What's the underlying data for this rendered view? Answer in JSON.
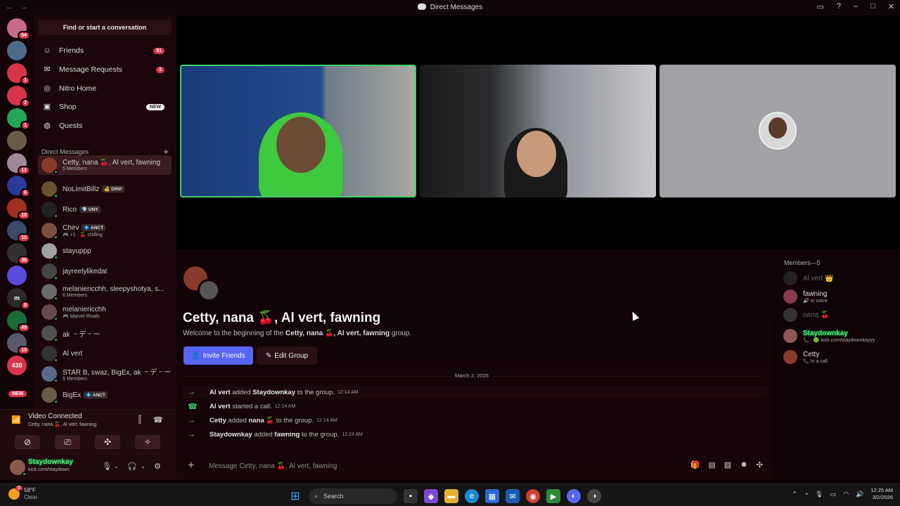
{
  "window": {
    "title": "Direct Messages"
  },
  "guilds": [
    {
      "label": "",
      "badge": "54",
      "color": "#c86a8a"
    },
    {
      "label": "",
      "badge": "",
      "color": "#4e6a8a"
    },
    {
      "label": "",
      "badge": "1",
      "color": "#d8344a"
    },
    {
      "label": "",
      "badge": "2",
      "color": "#d8344a"
    },
    {
      "label": "",
      "badge": "1",
      "color": "#23a55a"
    },
    {
      "label": "",
      "badge": "",
      "color": "#6a5a4a"
    },
    {
      "label": "",
      "badge": "12",
      "color": "#a08898"
    },
    {
      "label": "",
      "badge": "6",
      "color": "#2a3a9a"
    },
    {
      "label": "",
      "badge": "10",
      "color": "#a03020"
    },
    {
      "label": "",
      "badge": "10",
      "color": "#3a4a6a"
    },
    {
      "label": "",
      "badge": "38",
      "color": "#303030"
    },
    {
      "label": "",
      "badge": "",
      "color": "#5a4ae0"
    },
    {
      "label": "m",
      "badge": "9",
      "color": "#2a2a2a"
    },
    {
      "label": "",
      "badge": "49",
      "color": "#1a6a3a"
    },
    {
      "label": "",
      "badge": "10",
      "color": "#5a5a6a"
    },
    {
      "label": "430",
      "badge": "",
      "color": "#d8344a"
    }
  ],
  "sidebar": {
    "find_label": "Find or start a conversation",
    "nav": [
      {
        "label": "Friends",
        "count": "51",
        "icon": "friends-icon",
        "glyph": "☺"
      },
      {
        "label": "Message Requests",
        "count": "3",
        "icon": "mail-icon",
        "glyph": "✉"
      },
      {
        "label": "Nitro Home",
        "count": "",
        "icon": "nitro-icon",
        "glyph": "◎"
      },
      {
        "label": "Shop",
        "count": "",
        "badge": "NEW",
        "icon": "shop-icon",
        "glyph": "▣"
      },
      {
        "label": "Quests",
        "count": "",
        "icon": "quests-icon",
        "glyph": "◍"
      }
    ],
    "dm_header": "Direct Messages",
    "dms": [
      {
        "name": "Cetty, nana 🍒, Al vert, fawning",
        "sub": "5 Members",
        "tag": "",
        "color": "#8a3a2a",
        "active": true
      },
      {
        "name": "NoLimitBillz",
        "sub": "",
        "tag": "💰 DRIP",
        "color": "#6a5030"
      },
      {
        "name": "Rico",
        "sub": "",
        "tag": "💎 UNY",
        "color": "#222"
      },
      {
        "name": "Chev",
        "sub": "🎮 +1 · 🍒 chilling",
        "tag": "💠 ANCT",
        "color": "#7a5040"
      },
      {
        "name": "stayuppp",
        "sub": "",
        "tag": "",
        "color": "#a0a0a0"
      },
      {
        "name": "jayreelylikedat",
        "sub": "",
        "tag": "",
        "color": "#444"
      },
      {
        "name": "melaniericchh, sleepyshotya, s...",
        "sub": "6 Members",
        "tag": "",
        "color": "#6a6a6a"
      },
      {
        "name": "melaniericchh",
        "sub": "🎮 Marvel Rivals",
        "tag": "",
        "color": "#6a4a50"
      },
      {
        "name": "ak ゠デ゠ー",
        "sub": "",
        "tag": "",
        "color": "#505050"
      },
      {
        "name": "Al vert",
        "sub": "",
        "tag": "",
        "color": "#333"
      },
      {
        "name": "STAR B, swaz, BigEx, ak ゠デ゠ー",
        "sub": "5 Members",
        "tag": "",
        "color": "#5a6a8a"
      },
      {
        "name": "BigEx",
        "sub": "",
        "tag": "💠 ANCT",
        "color": "#6a5a4a"
      }
    ],
    "new_pill": "NEW"
  },
  "voice": {
    "title": "Video Connected",
    "subtitle": "Cetty, nana 🍒, Al vert, fawning"
  },
  "user": {
    "name": "Staydownkay",
    "status": "kick.com/staydown"
  },
  "video": {
    "tiles": [
      "tile-alvert",
      "tile-fawning",
      "tile-staydownkay"
    ]
  },
  "chat": {
    "title": "Cetty, nana 🍒, Al vert, fawning",
    "welcome_pre": "Welcome to the beginning of the ",
    "welcome_name": "Cetty, nana 🍒, Al vert, fawning",
    "welcome_post": " group.",
    "invite_label": "Invite Friends",
    "edit_label": "Edit Group",
    "date": "March 2, 2026",
    "messages": [
      {
        "actor": "Al vert",
        "action": "added",
        "target": "Staydownkay",
        "suffix": "to the group.",
        "time": "12:14 AM",
        "icon": "arrow"
      },
      {
        "actor": "Al vert",
        "action": "started a call.",
        "target": "",
        "suffix": "",
        "time": "12:14 AM",
        "icon": "phone"
      },
      {
        "actor": "Cetty",
        "action": "added",
        "target": "nana 🍒",
        "suffix": "to the group.",
        "time": "12:14 AM",
        "icon": "arrow"
      },
      {
        "actor": "Staydownkay",
        "action": "added",
        "target": "fawning",
        "suffix": "to the group.",
        "time": "12:24 AM",
        "icon": "arrow"
      }
    ],
    "placeholder": "Message Cetty, nana 🍒, Al vert, fawning"
  },
  "members": {
    "header": "Members—5",
    "list": [
      {
        "name": "Al vert 👑",
        "status": "",
        "dim": true,
        "color": "#222"
      },
      {
        "name": "fawning",
        "status": "🔊 In voice",
        "dim": false,
        "color": "#8a3a4a"
      },
      {
        "name": "nana 🍒",
        "status": "",
        "dim": true,
        "color": "#333"
      },
      {
        "name": "Staydownkay",
        "status": "📞 · 🟢 kick.com/staydownkayyy",
        "dim": false,
        "color": "#8a5a50",
        "special": true
      },
      {
        "name": "Cetty",
        "status": "📞 In a call",
        "dim": false,
        "color": "#8a3a2a"
      }
    ]
  },
  "taskbar": {
    "temp": "58°F",
    "weather": "Clear",
    "weather_badge": "6",
    "search": "Search",
    "time": "12:25 AM",
    "date": "3/2/2026"
  },
  "colors": {
    "accent": "#5865f2",
    "online": "#23a55a",
    "badge": "#d8344a",
    "speaking": "#3fd16d"
  }
}
